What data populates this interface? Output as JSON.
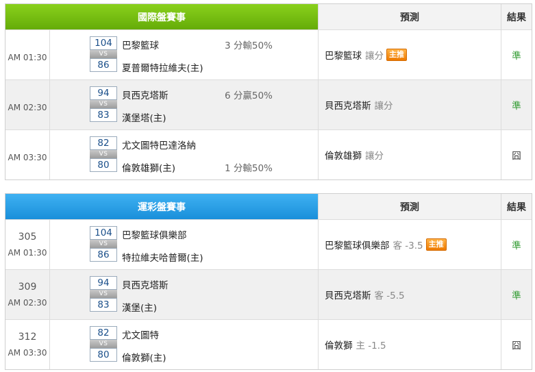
{
  "intl": {
    "header": {
      "game": "國際盤賽事",
      "predict": "預測",
      "result": "結果"
    },
    "rows": [
      {
        "time": "AM 01:30",
        "score1": "104",
        "score2": "86",
        "vs": "VS",
        "team1": "巴黎籃球",
        "team2": "夏普爾特拉維夫(主)",
        "odds1": "3 分輸50%",
        "odds2": "",
        "pred_team": "巴黎籃球",
        "pred_sub": "讓分",
        "badge": "主推",
        "result": "準"
      },
      {
        "time": "AM 02:30",
        "score1": "94",
        "score2": "83",
        "vs": "VS",
        "team1": "貝西克塔斯",
        "team2": "漢堡塔(主)",
        "odds1": "6 分贏50%",
        "odds2": "",
        "pred_team": "貝西克塔斯",
        "pred_sub": "讓分",
        "badge": "",
        "result": "準"
      },
      {
        "time": "AM 03:30",
        "score1": "82",
        "score2": "80",
        "vs": "VS",
        "team1": "尤文圖特巴達洛納",
        "team2": "倫敦雄獅(主)",
        "odds1": "",
        "odds2": "1 分輸50%",
        "pred_team": "倫敦雄獅",
        "pred_sub": "讓分",
        "badge": "",
        "result": "囧"
      }
    ]
  },
  "lottery": {
    "header": {
      "game": "運彩盤賽事",
      "predict": "預測",
      "result": "結果"
    },
    "rows": [
      {
        "num": "305",
        "time": "AM 01:30",
        "score1": "104",
        "score2": "86",
        "vs": "VS",
        "team1": "巴黎籃球俱樂部",
        "team2": "特拉維夫哈普爾(主)",
        "pred_team": "巴黎籃球俱樂部",
        "pred_sub": "客 -3.5",
        "badge": "主推",
        "result": "準"
      },
      {
        "num": "309",
        "time": "AM 02:30",
        "score1": "94",
        "score2": "83",
        "vs": "VS",
        "team1": "貝西克塔斯",
        "team2": "漢堡(主)",
        "pred_team": "貝西克塔斯",
        "pred_sub": "客 -5.5",
        "badge": "",
        "result": "準"
      },
      {
        "num": "312",
        "time": "AM 03:30",
        "score1": "82",
        "score2": "80",
        "vs": "VS",
        "team1": "尤文圖特",
        "team2": "倫敦獅(主)",
        "pred_team": "倫敦獅",
        "pred_sub": "主 -1.5",
        "badge": "",
        "result": "囧"
      }
    ]
  },
  "colors": {
    "green_header": "#7cc414",
    "blue_header": "#2ba2e8",
    "win": "#2f9a2f",
    "badge": "#f08a10"
  }
}
